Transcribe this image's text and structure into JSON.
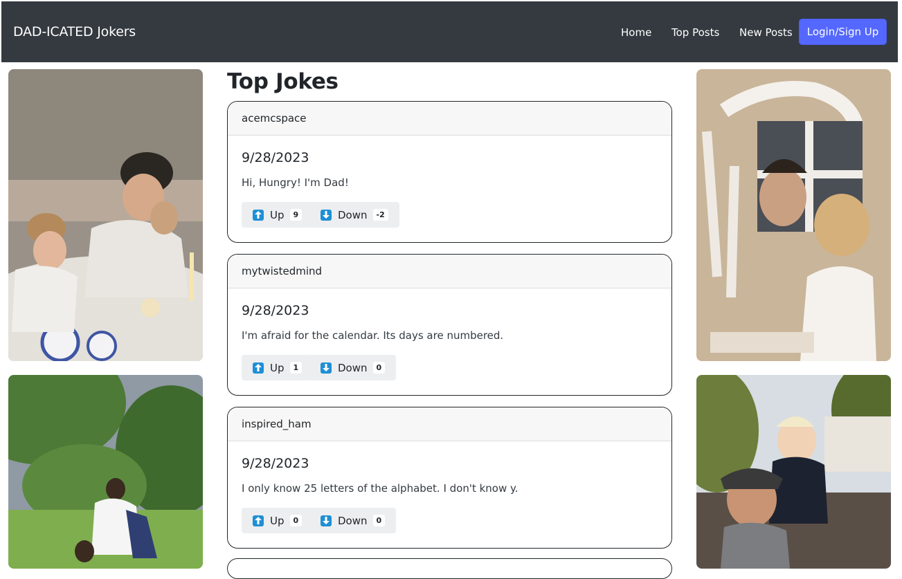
{
  "nav": {
    "brand": "DAD-ICATED Jokers",
    "links": [
      "Home",
      "Top Posts",
      "New Posts"
    ],
    "login_label": "Login/Sign Up"
  },
  "main": {
    "title": "Top Jokes",
    "posts": [
      {
        "user": "acemcspace",
        "date": "9/28/2023",
        "text": "Hi, Hungry! I'm Dad!",
        "up_label": "Up",
        "up_count": "9",
        "down_label": "Down",
        "down_count": "-2"
      },
      {
        "user": "mytwistedmind",
        "date": "9/28/2023",
        "text": "I'm afraid for the calendar. Its days are numbered.",
        "up_label": "Up",
        "up_count": "1",
        "down_label": "Down",
        "down_count": "0"
      },
      {
        "user": "inspired_ham",
        "date": "9/28/2023",
        "text": "I only know 25 letters of the alphabet. I don't know y.",
        "up_label": "Up",
        "up_count": "0",
        "down_label": "Down",
        "down_count": "0"
      }
    ]
  },
  "icons": {
    "up": "arrow-up-icon",
    "down": "arrow-down-icon"
  },
  "colors": {
    "navbar": "#343a40",
    "login_button": "#5468ff",
    "vote_icon": "#1f8fd6",
    "vote_button_bg": "#eceeef"
  }
}
